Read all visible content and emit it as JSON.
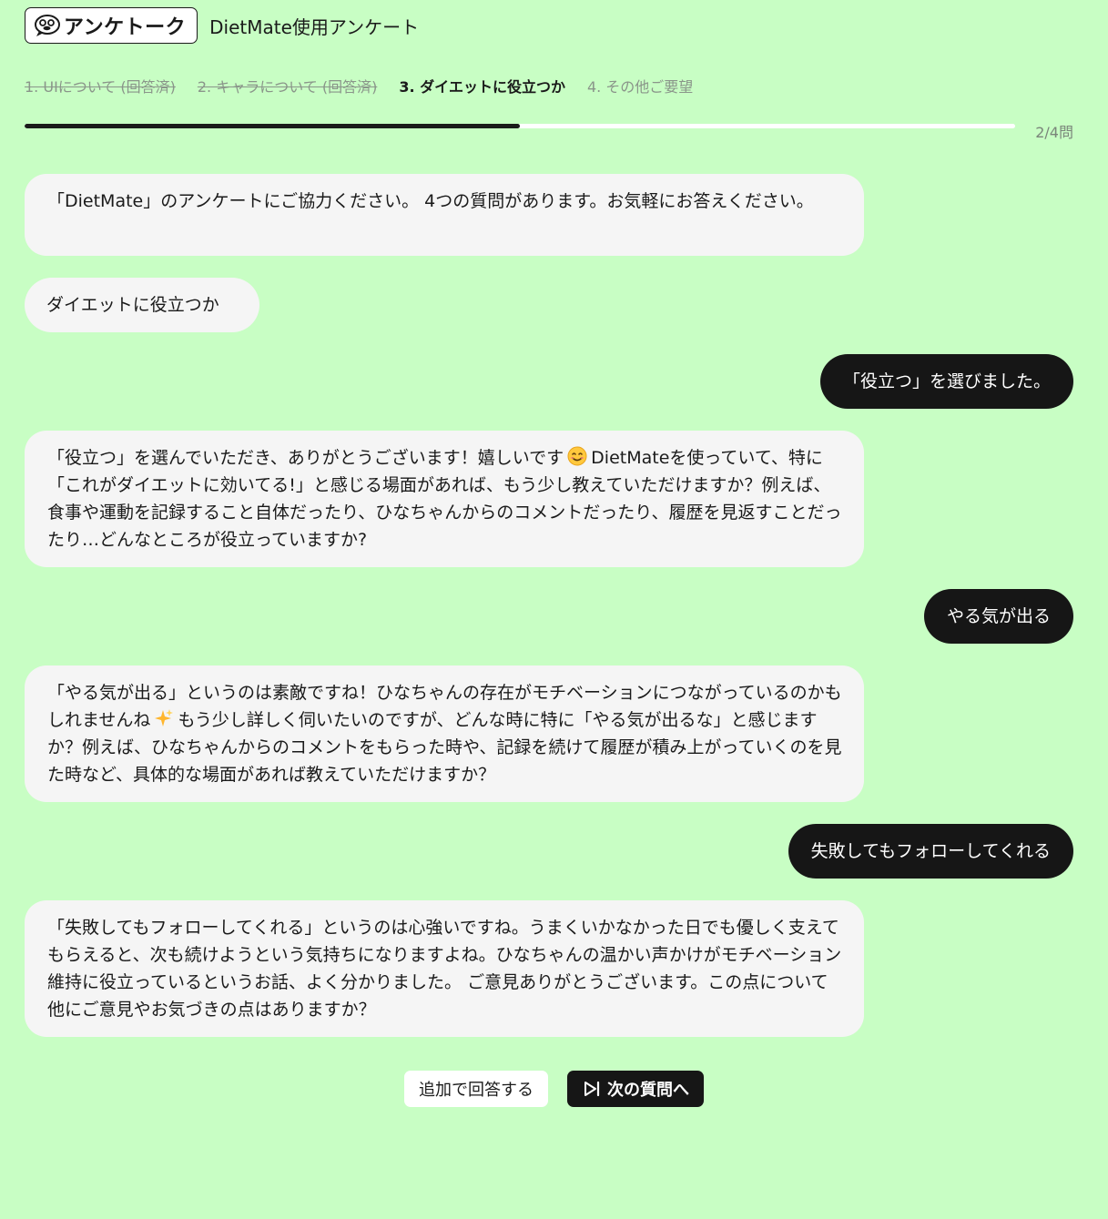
{
  "header": {
    "logo_text": "アンケトーク",
    "title": "DietMate使用アンケート"
  },
  "steps": [
    {
      "label": "1. UIについて (回答済)",
      "state": "done"
    },
    {
      "label": "2. キャラについて (回答済)",
      "state": "done"
    },
    {
      "label": "3. ダイエットに役立つか",
      "state": "active"
    },
    {
      "label": "4. その他ご要望",
      "state": "upcoming"
    }
  ],
  "progress": {
    "fraction": 0.5,
    "label": "2/4問"
  },
  "messages": {
    "m1": "「DietMate」のアンケートにご協力ください。 4つの質問があります。お気軽にお答えください。",
    "q3": "ダイエットに役立つか",
    "u1": "「役立つ」を選びました。",
    "m2_before_emoji": "「役立つ」を選んでいただき、ありがとうございます！嬉しいです",
    "m2_after_emoji": "DietMateを使っていて、特に「これがダイエットに効いてる!」と感じる場面があれば、もう少し教えていただけますか？例えば、食事や運動を記録すること自体だったり、ひなちゃんからのコメントだったり、履歴を見返すことだったり…どんなところが役立っていますか?",
    "u2": "やる気が出る",
    "m3_before_emoji": "「やる気が出る」というのは素敵ですね！ひなちゃんの存在がモチベーションにつながっているのかもしれませんね",
    "m3_after_emoji": "もう少し詳しく伺いたいのですが、どんな時に特に「やる気が出るな」と感じますか？例えば、ひなちゃんからのコメントをもらった時や、記録を続けて履歴が積み上がっていくのを見た時など、具体的な場面があれば教えていただけますか？",
    "u3": "失敗してもフォローしてくれる",
    "m4": "「失敗してもフォローしてくれる」というのは心強いですね。うまくいかなかった日でも優しく支えてもらえると、次も続けようという気持ちになりますよね。ひなちゃんの温かい声かけがモチベーション維持に役立っているというお話、よく分かりました。 ご意見ありがとうございます。この点について他にご意見やお気づきの点はありますか？"
  },
  "icons": {
    "logo": "chat-face-icon",
    "smile": "smiling-face-emoji",
    "sparkle": "sparkles-emoji",
    "next": "skip-next-icon"
  },
  "actions": {
    "additional_label": "追加で回答する",
    "next_label": "次の質問へ"
  },
  "colors": {
    "background": "#c8fec4",
    "bot_bubble": "#f5f5f5",
    "user_bubble": "#161616",
    "progress_fill": "#1a1a1a"
  }
}
